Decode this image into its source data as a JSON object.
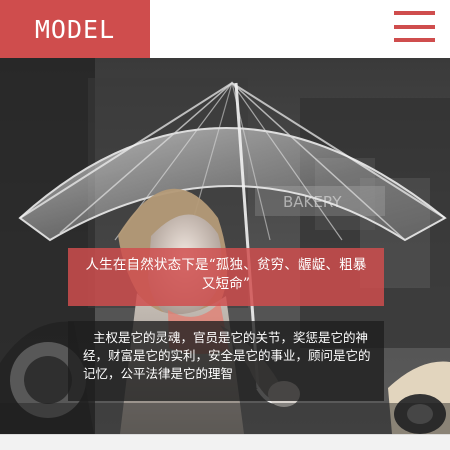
{
  "header": {
    "logo": "MODEL",
    "menu_icon": "hamburger-menu-icon"
  },
  "hero": {
    "image_semantic": "woman-holding-clear-umbrella",
    "caption_primary": "人生在自然状态下是“孤独、贫穷、龌龊、粗暴又短命”",
    "caption_secondary": "主权是它的灵魂，官员是它的关节，奖惩是它的神经，财富是它的实利，安全是它的事业，顾问是它的记忆，公平法律是它的理智"
  },
  "colors": {
    "accent": "#cf4d4d",
    "header_bg": "#ffffff",
    "dark_overlay": "#1e1e1e"
  }
}
